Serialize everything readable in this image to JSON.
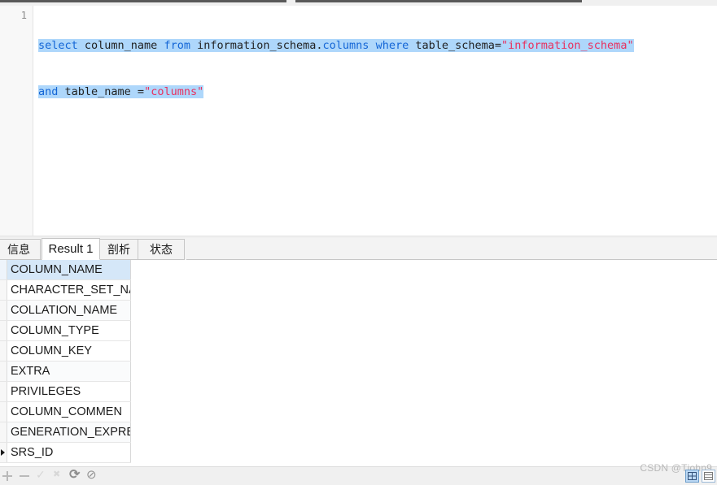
{
  "editor": {
    "line_number": "1",
    "query_full": "select column_name from information_schema.columns where table_schema=\"information_schema\" and table_name =\"columns\"",
    "line1": {
      "kw_select": "select",
      "id_column_name": " column_name ",
      "kw_from": "from",
      "id_information_schema": " information_schema.",
      "id_columns": "columns",
      "kw_where": " where",
      "id_table_schema": " table_schema=",
      "str_information_schema": "\"information_schema\""
    },
    "line2": {
      "kw_and": "and",
      "id_table_name": " table_name =",
      "str_columns": "\"columns\""
    },
    "colors": {
      "keyword": "#1466d6",
      "string": "#e8315f",
      "identifier": "#222222",
      "selection": "#aed7fb"
    }
  },
  "tabs": [
    {
      "label": "信息",
      "name": "tab-info",
      "active": false
    },
    {
      "label": "Result 1",
      "name": "tab-result-1",
      "active": true
    },
    {
      "label": "剖析",
      "name": "tab-profile",
      "active": false
    },
    {
      "label": "状态",
      "name": "tab-status",
      "active": false
    }
  ],
  "result_grid": {
    "column_header": "",
    "rows": [
      {
        "value": "COLUMN_NAME"
      },
      {
        "value": "CHARACTER_SET_NA"
      },
      {
        "value": "COLLATION_NAME"
      },
      {
        "value": "COLUMN_TYPE"
      },
      {
        "value": "COLUMN_KEY"
      },
      {
        "value": "EXTRA"
      },
      {
        "value": "PRIVILEGES"
      },
      {
        "value": "COLUMN_COMMEN"
      },
      {
        "value": "GENERATION_EXPRE"
      },
      {
        "value": "SRS_ID"
      }
    ],
    "selected_row_index": 0,
    "current_row_index": 9,
    "selection_color": "#d5e7f8"
  },
  "bottom_bar": {
    "icons": [
      {
        "name": "add-record-icon",
        "glyph": "plus"
      },
      {
        "name": "delete-record-icon",
        "glyph": "minus"
      },
      {
        "name": "apply-changes-icon",
        "glyph": "check"
      },
      {
        "name": "cancel-changes-icon",
        "glyph": "cross"
      },
      {
        "name": "refresh-icon",
        "glyph": "refresh"
      },
      {
        "name": "stop-icon",
        "glyph": "stop"
      }
    ],
    "watermark": "CSDN @Tjohn9",
    "view_grid_label": "",
    "view_form_label": ""
  }
}
